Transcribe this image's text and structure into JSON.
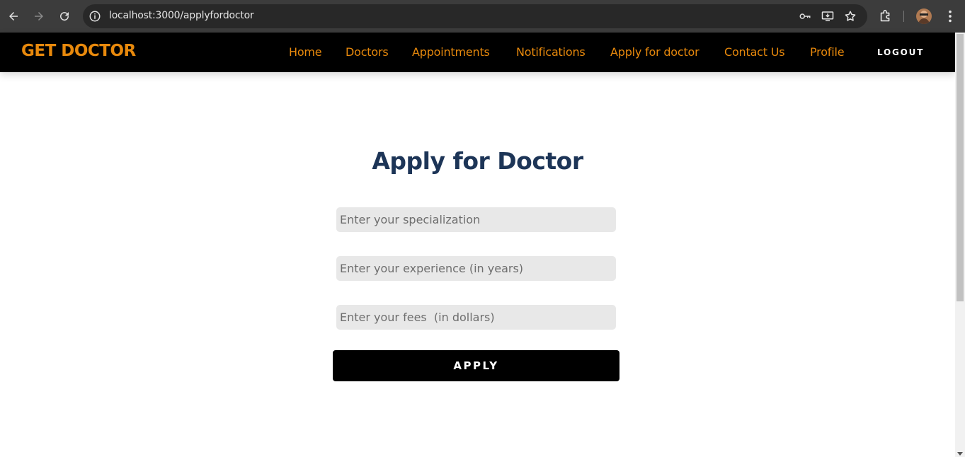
{
  "browser": {
    "url": "localhost:3000/applyfordoctor",
    "icons": [
      "back-arrow-icon",
      "forward-arrow-icon",
      "reload-icon",
      "site-info-icon",
      "password-key-icon",
      "install-app-icon",
      "bookmark-star-icon",
      "extensions-puzzle-icon",
      "profile-avatar",
      "kebab-menu-icon"
    ]
  },
  "navbar": {
    "brand": "GET DOCTOR",
    "links": [
      "Home",
      "Doctors",
      "Appointments",
      "Notifications",
      "Apply for doctor",
      "Contact Us",
      "Profile"
    ],
    "logout": "LOGOUT",
    "accent_color": "#e8890c",
    "background_color": "#000000"
  },
  "form": {
    "title": "Apply for Doctor",
    "title_color": "#1d3557",
    "fields": [
      {
        "placeholder": "Enter your specialization",
        "value": ""
      },
      {
        "placeholder": "Enter your experience (in years)",
        "value": ""
      },
      {
        "placeholder": "Enter your fees  (in dollars)",
        "value": ""
      }
    ],
    "submit_label": "APPLY"
  }
}
